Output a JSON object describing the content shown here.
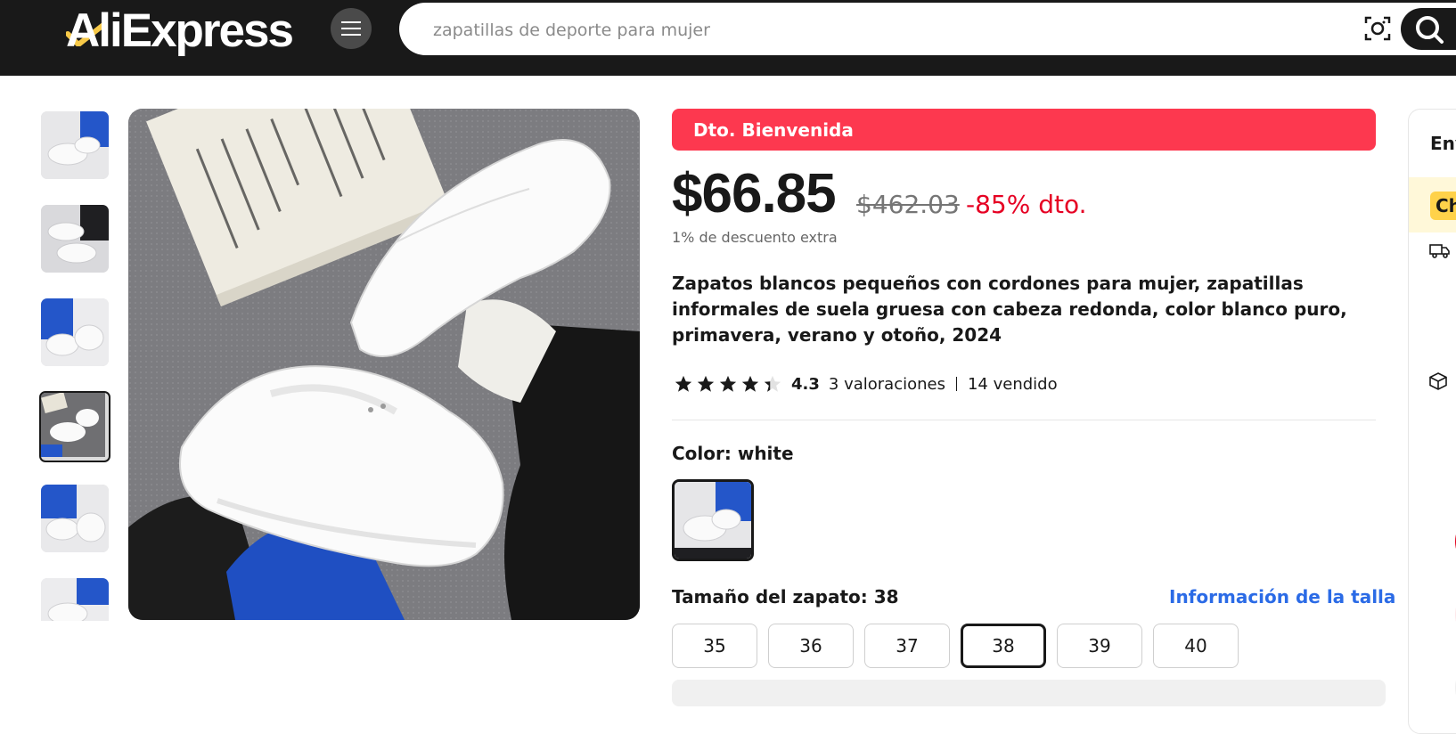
{
  "header": {
    "logo_text": "AliExpress",
    "menu_icon": "hamburger-icon",
    "search": {
      "placeholder": "zapatillas de deporte para mujer",
      "value": ""
    },
    "camera_icon": "camera-search-icon",
    "search_icon": "search-icon"
  },
  "gallery": {
    "thumbnails": [
      {
        "label": "thumbnail-1"
      },
      {
        "label": "thumbnail-2"
      },
      {
        "label": "thumbnail-3"
      },
      {
        "label": "thumbnail-4",
        "selected": true
      },
      {
        "label": "thumbnail-5"
      },
      {
        "label": "thumbnail-6"
      }
    ]
  },
  "product": {
    "banner": "Dto. Bienvenida",
    "price": "$66.85",
    "old_price": "$462.03",
    "discount": "-85% dto.",
    "extra_discount": "1% de descuento extra",
    "title": "Zapatos blancos pequeños con cordones para mujer, zapatillas informales de suela gruesa con cabeza redonda, color blanco puro, primavera, verano y otoño, 2024",
    "rating": {
      "value": "4.3",
      "stars": 4.3,
      "reviews": "3 valoraciones",
      "sold": "14 vendido"
    },
    "color": {
      "label": "Color: white"
    },
    "size": {
      "label": "Tamaño del zapato: 38",
      "info_link": "Información de la talla",
      "options": [
        "35",
        "36",
        "37",
        "38",
        "39",
        "40"
      ],
      "selected": "38"
    }
  },
  "side_panel": {
    "title_partial": "Env",
    "chip_partial": "Ch"
  },
  "colors": {
    "header_bg": "#191919",
    "banner_red": "#fd384f",
    "discount_red": "#e60023",
    "link_blue": "#2b6be6"
  }
}
